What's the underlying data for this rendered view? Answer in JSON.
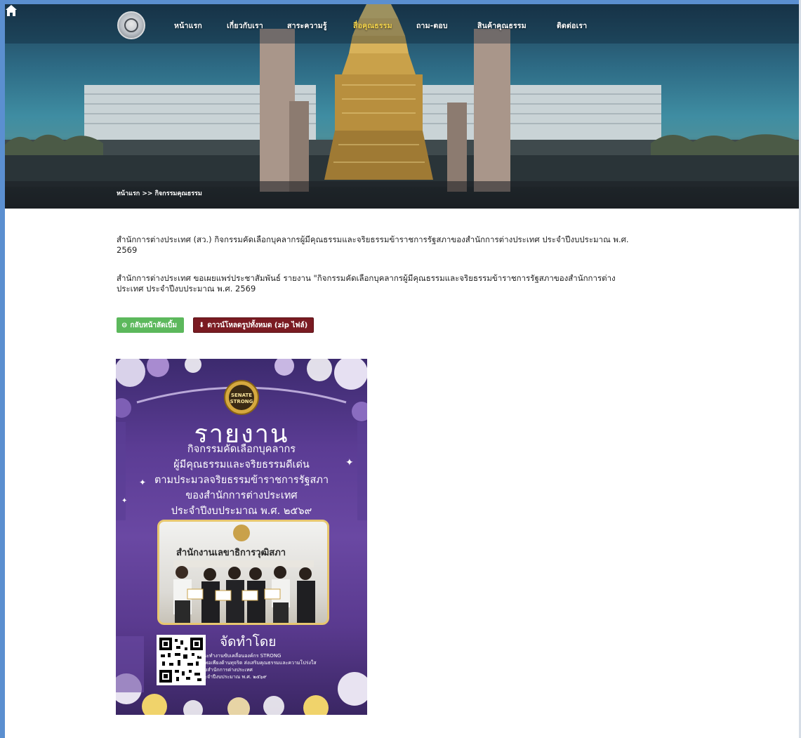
{
  "nav": {
    "items": [
      "หน้าแรก",
      "เกี่ยวกับเรา",
      "สาระความรู้",
      "สื่อคุณธรรม",
      "ถาม-ตอบ",
      "สินค้าคุณธรรม",
      "ติดต่อเรา"
    ],
    "active_index": 3,
    "logo_icon": "senate-emblem-icon",
    "home_icon": "home-icon"
  },
  "breadcrumb": {
    "text": "หน้าแรก >> กิจกรรมคุณธรรม"
  },
  "content": {
    "heading": "สำนักการต่างประเทศ (สว.) กิจกรรมคัดเลือกบุคลากรผู้มีคุณธรรมและจริยธรรมข้าราชการรัฐสภาของสำนักการต่างประเทศ ประจำปีงบประมาณ พ.ศ. 2569",
    "description": "สำนักการต่างประเทศ ขอเผยแพร่ประชาสัมพันธ์ รายงาน \"กิจกรรมคัดเลือกบุคลากรผู้มีคุณธรรมและจริยธรรมข้าราชการรัฐสภาของสำนักการต่างประเทศ ประจำปีงบประมาณ พ.ศ. 2569"
  },
  "buttons": {
    "back_label": "กลับหน้าลัดเบิ้ม",
    "back_icon": "back-circle-icon",
    "download_label": "ดาวน์โหลดรูปทั้งหมด (zip ไฟล์)",
    "download_icon": "download-icon",
    "back_color": "#5cb85c",
    "download_color": "#7a1b22"
  },
  "poster": {
    "badge_line1": "SENATE",
    "badge_line2": "STRONG",
    "title": "รายงาน",
    "lines": [
      "กิจกรรมคัดเลือกบุคลากร",
      "ผู้มีคุณธรรมและจริยธรรมดีเด่น",
      "ตามประมวลจริยธรรมข้าราชการรัฐสภา",
      "ของสำนักการต่างประเทศ",
      "ประจำปีงบประมาณ พ.ศ. ๒๕๖๙"
    ],
    "photo_banner": "สำนักงานเลขาธิการวุฒิสภา",
    "made_by": "จัดทำโดย",
    "small_lines": [
      "คณะทำงานขับเคลื่อนองค์กร STRONG",
      "จิตพอเพียงต้านทุจริต ส่งเสริมคุณธรรมและความโปร่งใส",
      "ของสำนักการต่างประเทศ",
      "ประจำปีงบประมาณ พ.ศ. ๒๕๖๙"
    ]
  }
}
